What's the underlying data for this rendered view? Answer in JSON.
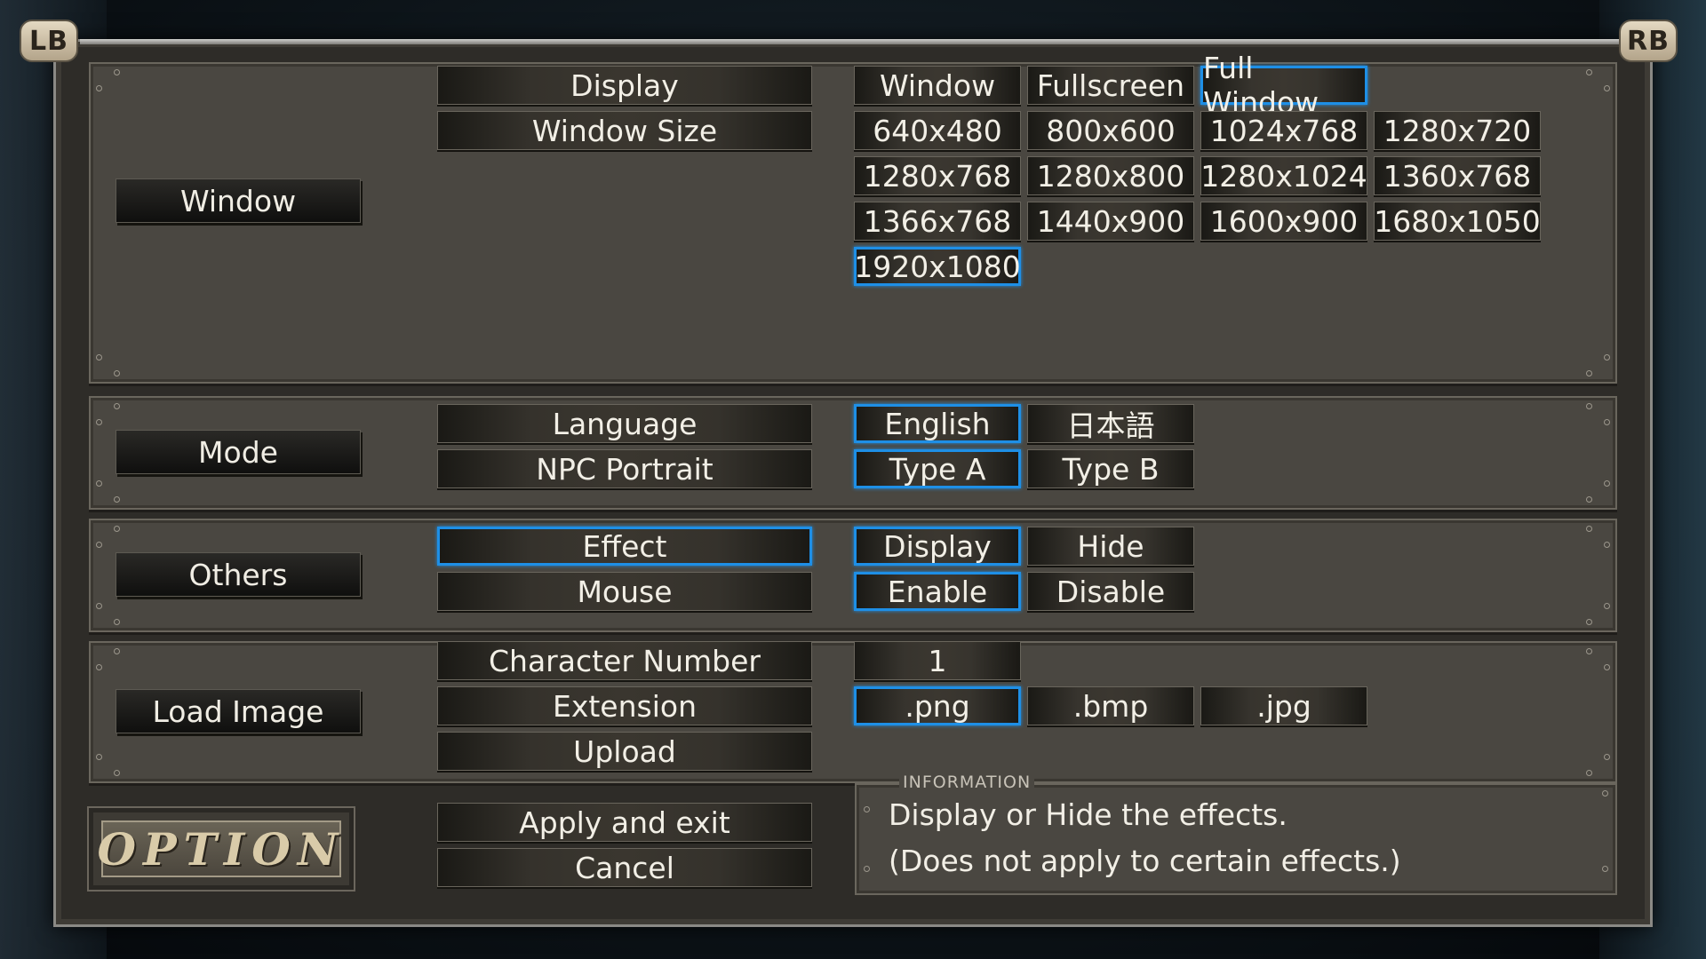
{
  "bumpers": {
    "left": "LB",
    "right": "RB"
  },
  "sections": {
    "window": {
      "category": "Window",
      "display_label": "Display",
      "display_options": [
        "Window",
        "Fullscreen",
        "Full Window"
      ],
      "display_selected": "Full Window",
      "size_label": "Window Size",
      "size_options": [
        "640x480",
        "800x600",
        "1024x768",
        "1280x720",
        "1280x768",
        "1280x800",
        "1280x1024",
        "1360x768",
        "1366x768",
        "1440x900",
        "1600x900",
        "1680x1050",
        "1920x1080"
      ],
      "size_selected": "1920x1080"
    },
    "mode": {
      "category": "Mode",
      "language_label": "Language",
      "language_options": [
        "English",
        "日本語"
      ],
      "language_selected": "English",
      "portrait_label": "NPC Portrait",
      "portrait_options": [
        "Type A",
        "Type B"
      ],
      "portrait_selected": "Type A"
    },
    "others": {
      "category": "Others",
      "effect_label": "Effect",
      "effect_options": [
        "Display",
        "Hide"
      ],
      "effect_selected": "Display",
      "mouse_label": "Mouse",
      "mouse_options": [
        "Enable",
        "Disable"
      ],
      "mouse_selected": "Enable"
    },
    "load_image": {
      "category": "Load Image",
      "char_label": "Character Number",
      "char_value": "1",
      "ext_label": "Extension",
      "ext_options": [
        ".png",
        ".bmp",
        ".jpg"
      ],
      "ext_selected": ".png",
      "upload_label": "Upload"
    }
  },
  "footer": {
    "badge": "OPTION",
    "apply_label": "Apply and exit",
    "cancel_label": "Cancel"
  },
  "info": {
    "title": "INFORMATION",
    "line1": "Display or Hide the effects.",
    "line2": "(Does not apply to certain effects.)"
  },
  "colors": {
    "selection": "#1e8fe6",
    "panel": "#4a4741",
    "frame": "#2e2c28"
  }
}
